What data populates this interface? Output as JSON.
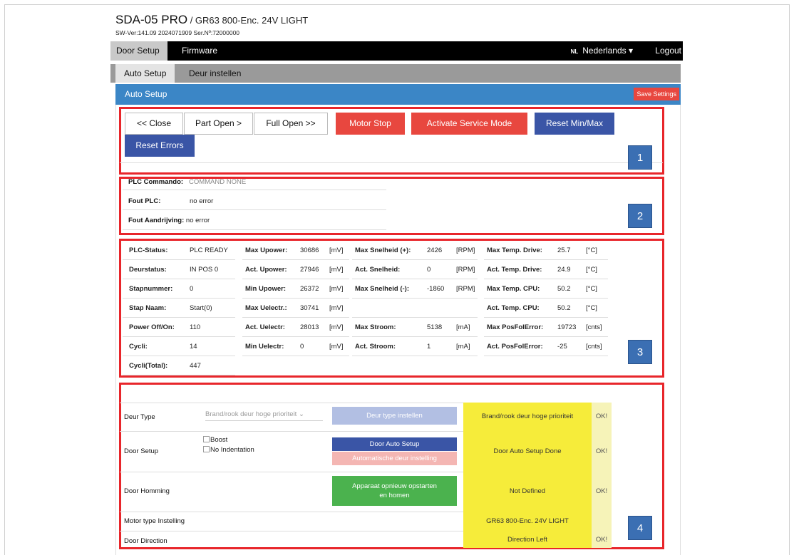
{
  "header": {
    "model": "SDA-05 PRO",
    "subtitle": " / GR63 800-Enc. 24V LIGHT",
    "version": "SW-Ver:141.09  2024071909  Ser.Nº:72000000"
  },
  "nav": {
    "tabs": [
      "Door Setup",
      "Firmware"
    ],
    "lang_code": "NL",
    "language": "Nederlands ▾",
    "logout": "Logout"
  },
  "subnav": {
    "tabs": [
      "Auto Setup",
      "Deur instellen"
    ]
  },
  "panel": {
    "title": "Auto Setup",
    "save": "Save Settings"
  },
  "controls": {
    "close": "<< Close",
    "part_open": "Part Open >",
    "full_open": "Full Open >>",
    "motor_stop": "Motor Stop",
    "service": "Activate Service Mode",
    "reset_minmax": "Reset Min/Max",
    "reset_errors": "Reset Errors"
  },
  "markers": [
    "1",
    "2",
    "3",
    "4"
  ],
  "plc": {
    "commando_label": "PLC Commando:",
    "commando_value": "COMMAND NONE",
    "fout_plc_label": "Fout PLC:",
    "fout_plc_value": "no error",
    "fout_drive_label": "Fout Aandrijving:",
    "fout_drive_value": "no error"
  },
  "status": {
    "col1": [
      {
        "label": "PLC-Status:",
        "value": "PLC READY"
      },
      {
        "label": "Deurstatus:",
        "value": "IN POS 0"
      },
      {
        "label": "Stapnummer:",
        "value": "0"
      },
      {
        "label": "Stap Naam:",
        "value": "Start(0)"
      },
      {
        "label": "Power Off/On:",
        "value": "110"
      },
      {
        "label": "Cycli:",
        "value": "14"
      },
      {
        "label": "Cycli(Total):",
        "value": "447"
      }
    ],
    "col2": [
      {
        "label": "Max Upower:",
        "value": "30686",
        "unit": "[mV]"
      },
      {
        "label": "Act. Upower:",
        "value": "27946",
        "unit": "[mV]"
      },
      {
        "label": "Min Upower:",
        "value": "26372",
        "unit": "[mV]"
      },
      {
        "label": "Max Uelectr.:",
        "value": "30741",
        "unit": "[mV]"
      },
      {
        "label": "Act. Uelectr:",
        "value": "28013",
        "unit": "[mV]"
      },
      {
        "label": "Min Uelectr:",
        "value": "0",
        "unit": "[mV]"
      }
    ],
    "col3": [
      {
        "label": "Max Snelheid (+):",
        "value": "2426",
        "unit": "[RPM]"
      },
      {
        "label": "Act. Snelheid:",
        "value": "0",
        "unit": "[RPM]"
      },
      {
        "label": "Max Snelheid (-):",
        "value": "-1860",
        "unit": "[RPM]"
      },
      {
        "label": "",
        "value": "",
        "unit": ""
      },
      {
        "label": "Max Stroom:",
        "value": "5138",
        "unit": "[mA]"
      },
      {
        "label": "Act. Stroom:",
        "value": "1",
        "unit": "[mA]"
      }
    ],
    "col4": [
      {
        "label": "Max Temp. Drive:",
        "value": "25.7",
        "unit": "[°C]"
      },
      {
        "label": "Act. Temp. Drive:",
        "value": "24.9",
        "unit": "[°C]"
      },
      {
        "label": "Max Temp. CPU:",
        "value": "50.2",
        "unit": "[°C]"
      },
      {
        "label": "Act. Temp. CPU:",
        "value": "50.2",
        "unit": "[°C]"
      },
      {
        "label": "Max PosFolError:",
        "value": "19723",
        "unit": "[cnts]"
      },
      {
        "label": "Act. PosFolError:",
        "value": "-25",
        "unit": "[cnts]"
      }
    ]
  },
  "setup": {
    "deur_type_label": "Deur Type",
    "deur_type_select": "Brand/rook deur hoge prioriteit ⌄",
    "deur_type_btn": "Deur type instellen",
    "deur_type_status": "Brand/rook deur hoge prioriteit",
    "deur_type_ok": "OK!",
    "door_setup_label": "Door Setup",
    "boost": "Boost",
    "no_indent": "No Indentation",
    "auto_setup_btn": "Door Auto Setup",
    "auto_instelling_btn": "Automatische deur instelling",
    "door_setup_status": "Door Auto Setup Done",
    "door_setup_ok": "OK!",
    "homming_label": "Door Homming",
    "homming_btn_1": "Apparaat opnieuw opstarten",
    "homming_btn_2": "en homen",
    "homming_status": "Not Defined",
    "homming_ok": "OK!",
    "motor_label": "Motor type Instelling",
    "motor_status": "GR63 800-Enc. 24V LIGHT",
    "direction_label": "Door Direction",
    "direction_status": "Direction Left",
    "direction_ok": "OK!"
  }
}
